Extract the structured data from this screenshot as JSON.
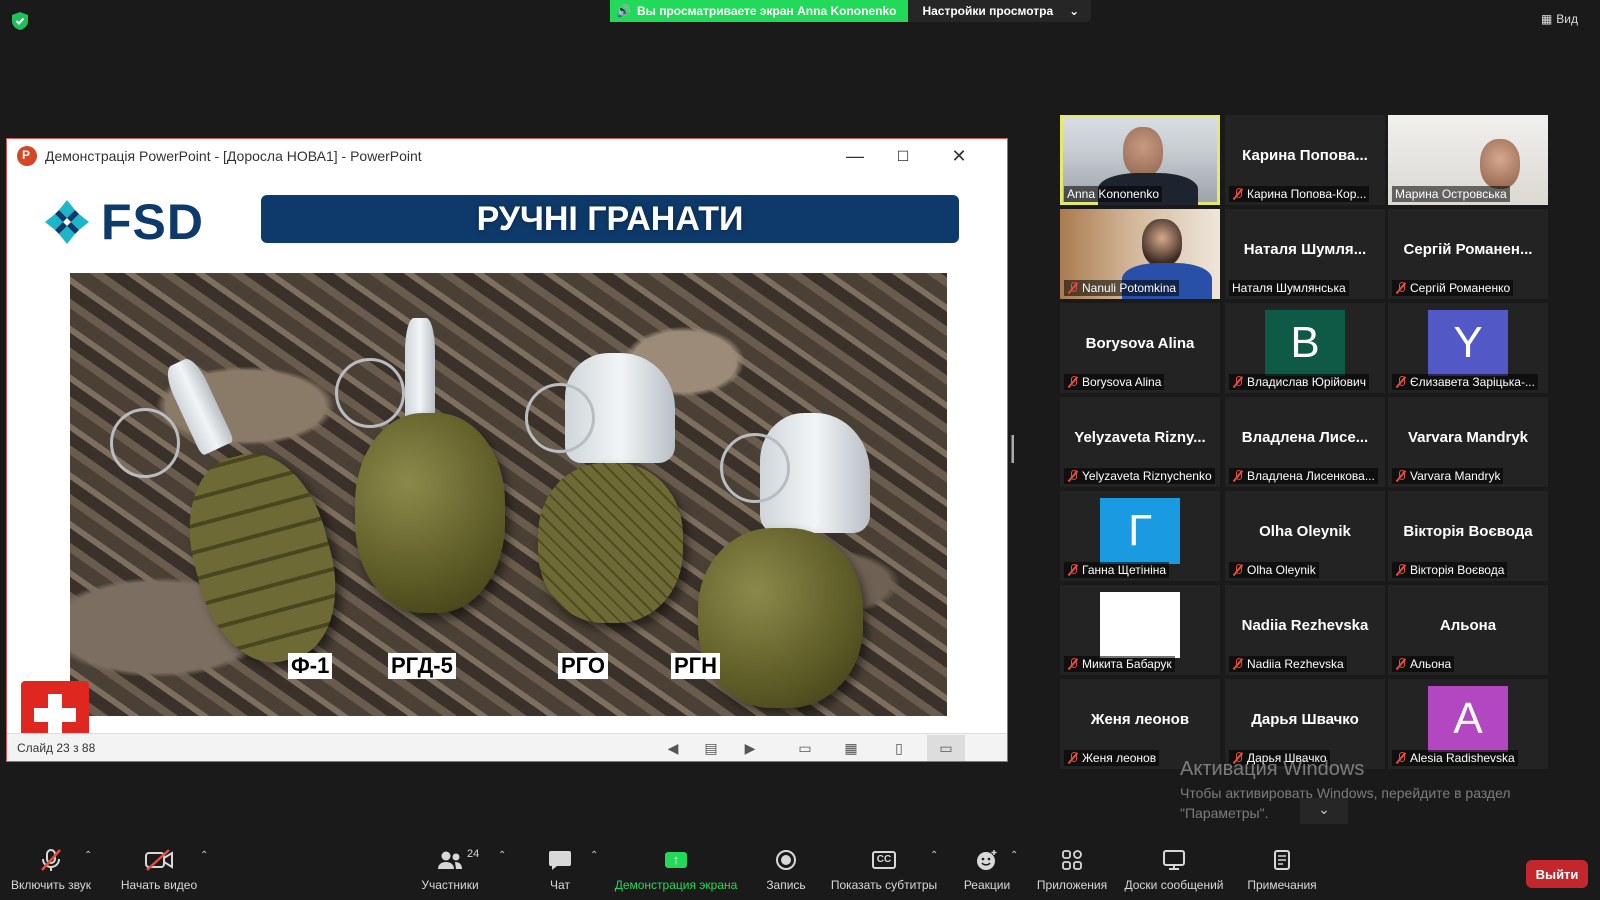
{
  "top": {
    "share_notice": "Вы просматриваете экран Anna Kononenko",
    "view_settings": "Настройки просмотра",
    "view_label": "Вид"
  },
  "ppt": {
    "window_title": "Демонстрація PowerPoint - [Доросла НОВА1] - PowerPoint",
    "slide_status": "Слайд 23 з 88",
    "slide": {
      "logo_text": "FSD",
      "title": "РУЧНІ ГРАНАТИ",
      "labels": [
        "Ф-1",
        "РГД-5",
        "РГО",
        "РГН"
      ]
    }
  },
  "gallery": [
    {
      "big": "",
      "name": "Anna Kononenko",
      "muted": false,
      "kind": "video-anna",
      "active": true
    },
    {
      "big": "Карина Попова...",
      "name": "Карина Попова-Кор...",
      "muted": true
    },
    {
      "big": "",
      "name": "Марина Островська",
      "muted": false,
      "kind": "video-marina"
    },
    {
      "big": "",
      "name": "Nanuli Potomkina",
      "muted": true,
      "kind": "video-nanuli"
    },
    {
      "big": "Наталя Шумля...",
      "name": "Наталя Шумлянська",
      "muted": false
    },
    {
      "big": "Сергій Романен...",
      "name": "Сергій Романенко",
      "muted": true
    },
    {
      "big": "Borysova Alina",
      "name": "Borysova Alina",
      "muted": true
    },
    {
      "big": "",
      "name": "Владислав Юрійович",
      "muted": true,
      "avatar": "B",
      "avatar_color": "#0f5a46"
    },
    {
      "big": "",
      "name": "Єлизавета Зарiцька-...",
      "muted": true,
      "avatar": "Y",
      "avatar_color": "#5259c6"
    },
    {
      "big": "Yelyzaveta Rizny...",
      "name": "Yelyzaveta Riznychenko",
      "muted": true
    },
    {
      "big": "Владлена Лисе...",
      "name": "Владлена Лисенкова...",
      "muted": true
    },
    {
      "big": "Varvara Mandryk",
      "name": "Varvara Mandryk",
      "muted": true
    },
    {
      "big": "",
      "name": "Ганна Щетініна",
      "muted": true,
      "avatar": "Г",
      "avatar_color": "#1a9ae0"
    },
    {
      "big": "Olha Oleynik",
      "name": "Olha Oleynik",
      "muted": true
    },
    {
      "big": "Вікторія Воєвода",
      "name": "Вікторія Воєвода",
      "muted": true
    },
    {
      "big": "",
      "name": "Микита Бабарук",
      "muted": true,
      "avatar": "",
      "avatar_color": "#ffffff"
    },
    {
      "big": "Nadiia Rezhevska",
      "name": "Nadiia Rezhevska",
      "muted": true
    },
    {
      "big": "Альона",
      "name": "Альона",
      "muted": true
    },
    {
      "big": "Женя леонов",
      "name": "Женя леонов",
      "muted": true
    },
    {
      "big": "Дарья Швачко",
      "name": "Дарья Швачко",
      "muted": true
    },
    {
      "big": "",
      "name": "Alesia Radishevska",
      "muted": true,
      "avatar": "A",
      "avatar_color": "#b347c2"
    }
  ],
  "watermark": {
    "line1": "Активация Windows",
    "line2": "Чтобы активировать Windows, перейдите в раздел \"Параметры\"."
  },
  "toolbar": {
    "unmute": "Включить звук",
    "start_video": "Начать видео",
    "participants": "Участники",
    "participants_count": "24",
    "chat": "Чат",
    "share": "Демонстрация экрана",
    "record": "Запись",
    "captions": "Показать субтитры",
    "captions_icon": "CC",
    "reactions": "Реакции",
    "apps": "Приложения",
    "whiteboards": "Доски сообщений",
    "notes": "Примечания",
    "leave": "Выйти"
  }
}
